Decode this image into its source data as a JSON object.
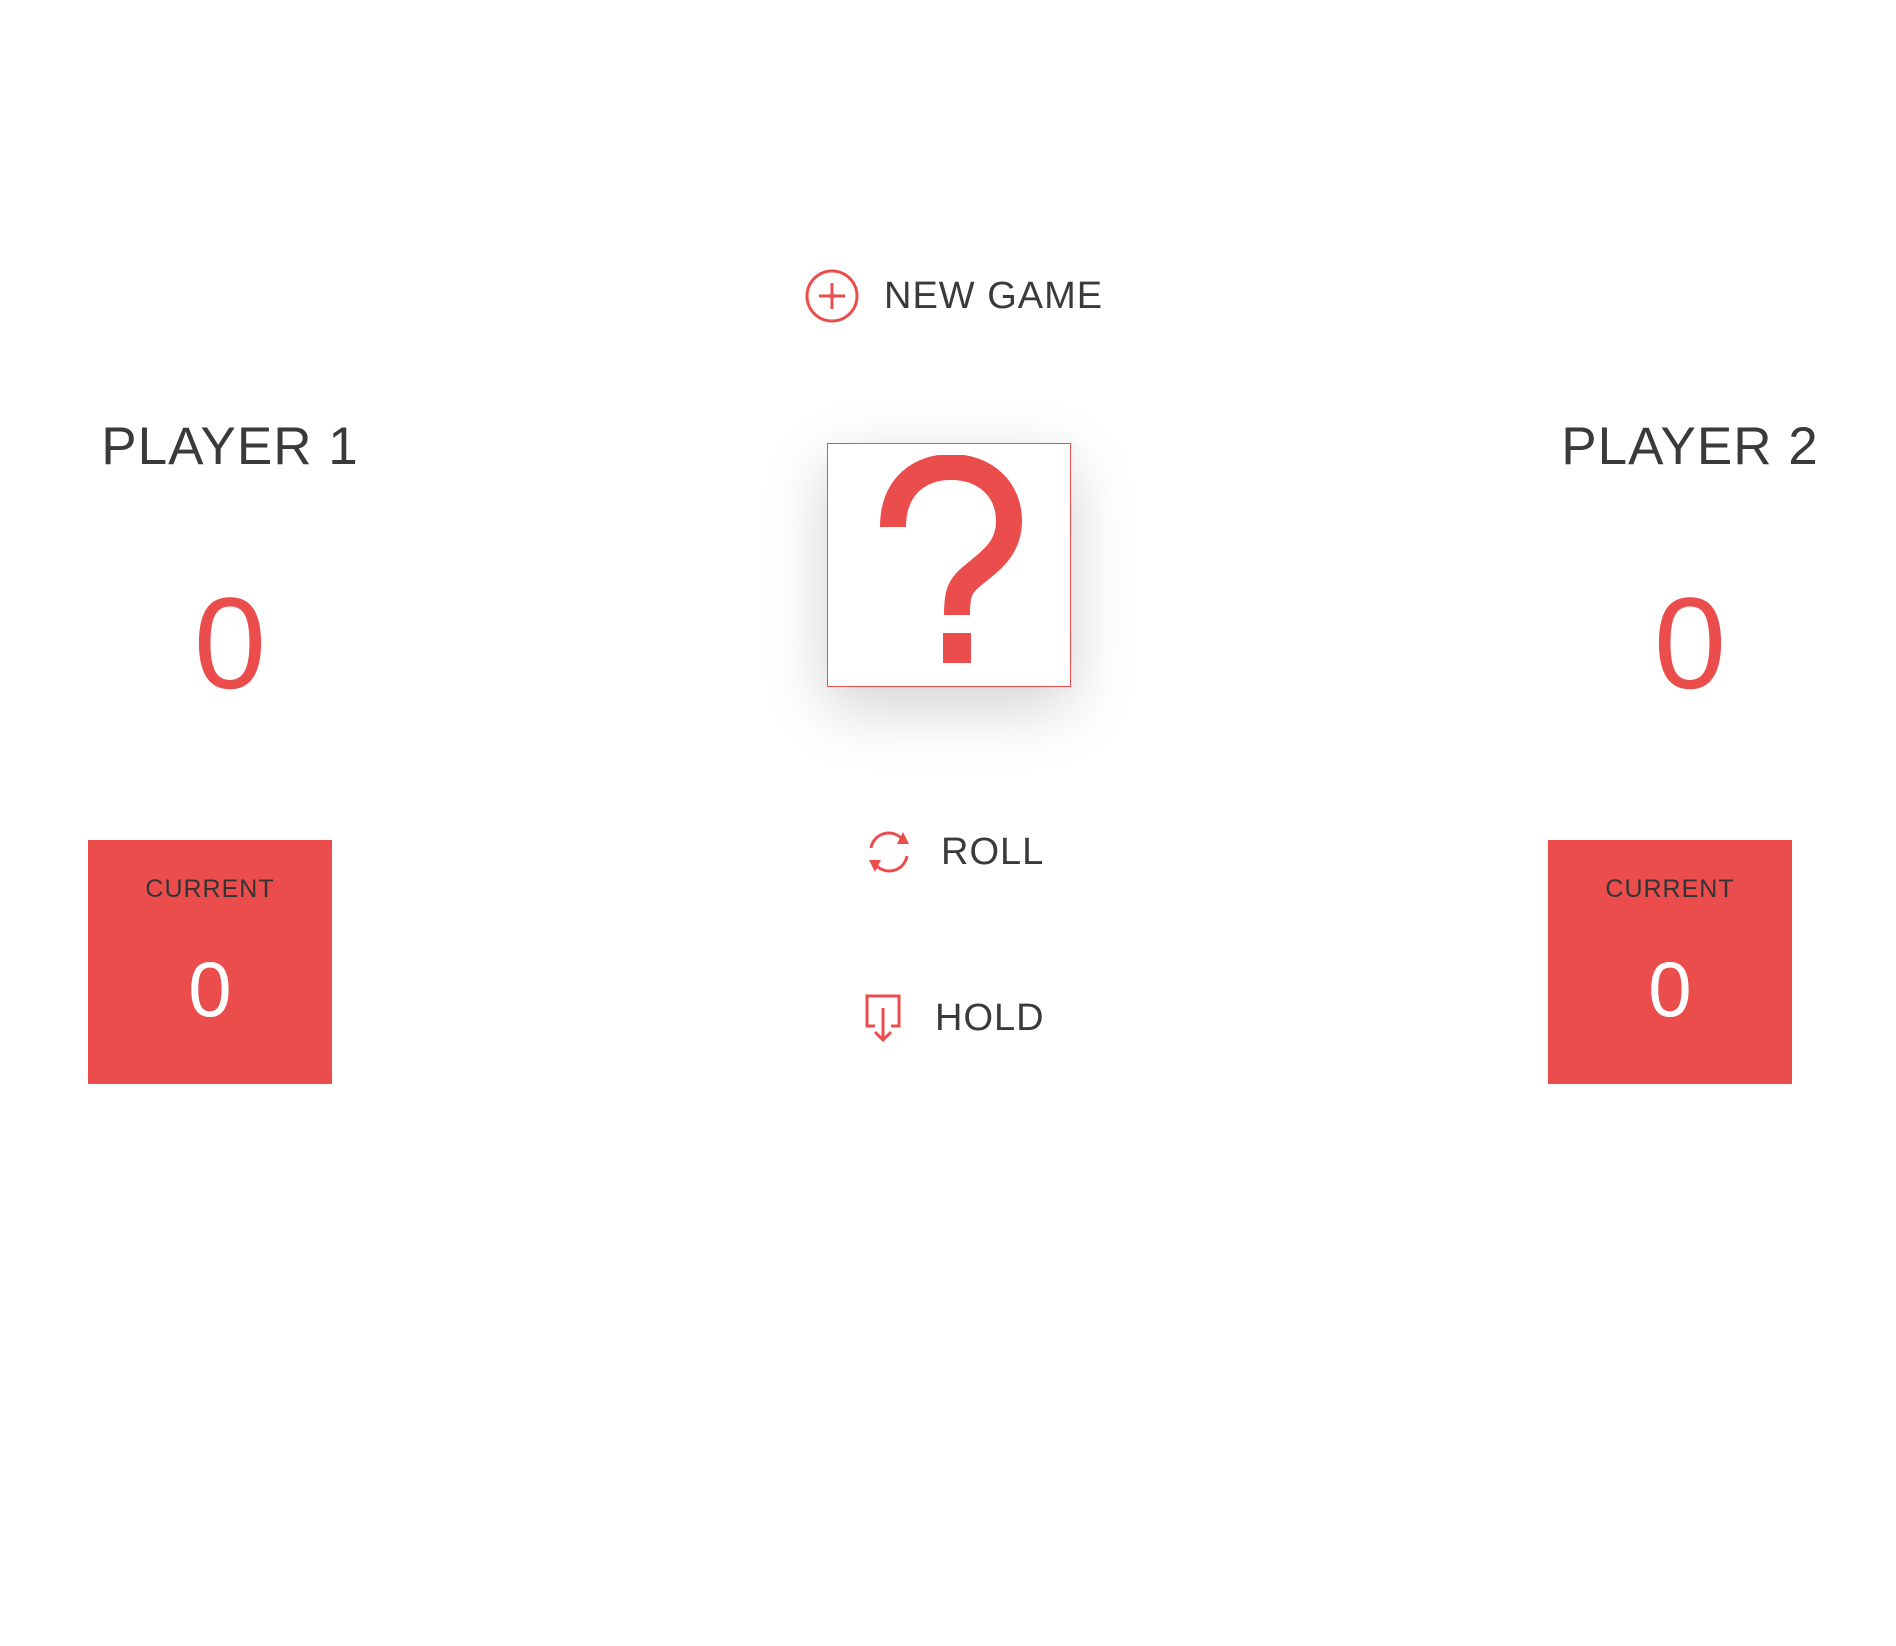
{
  "colors": {
    "accent": "#eb4d4d",
    "text": "#3a3a3a",
    "background": "#ffffff"
  },
  "players": [
    {
      "name": "PLAYER 1",
      "score": "0",
      "current_label": "CURRENT",
      "current_score": "0"
    },
    {
      "name": "PLAYER 2",
      "score": "0",
      "current_label": "CURRENT",
      "current_score": "0"
    }
  ],
  "controls": {
    "new_game": {
      "label": "NEW GAME",
      "icon": "plus-circle-icon"
    },
    "roll": {
      "label": "ROLL",
      "icon": "refresh-icon"
    },
    "hold": {
      "label": "HOLD",
      "icon": "download-icon"
    }
  },
  "dice": {
    "icon": "question-mark-icon"
  }
}
